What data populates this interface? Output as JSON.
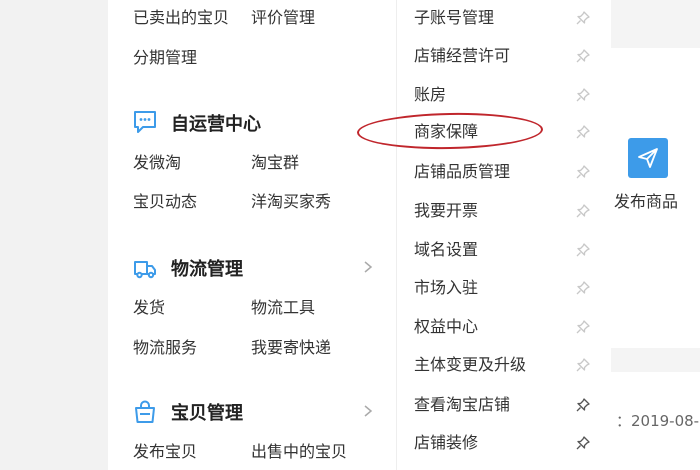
{
  "seller_menu": {
    "top_links": [
      "已卖出的宝贝",
      "评价管理",
      "分期管理"
    ],
    "sections": [
      {
        "title": "自运营中心",
        "icon": "chat-bubble-icon",
        "links": [
          "发微淘",
          "淘宝群",
          "宝贝动态",
          "洋淘买家秀"
        ]
      },
      {
        "title": "物流管理",
        "icon": "delivery-truck-icon",
        "links": [
          "发货",
          "物流工具",
          "物流服务",
          "我要寄快递"
        ]
      },
      {
        "title": "宝贝管理",
        "icon": "shopping-bag-icon",
        "links": [
          "发布宝贝",
          "出售中的宝贝"
        ]
      }
    ]
  },
  "submenu": {
    "items": [
      "子账号管理",
      "店铺经营许可",
      "账房",
      "商家保障",
      "店铺品质管理",
      "我要开票",
      "域名设置",
      "市场入驻",
      "权益中心",
      "主体变更及升级",
      "查看淘宝店铺",
      "店铺装修"
    ],
    "highlighted": "商家保障"
  },
  "right_panel": {
    "publish_label": "发布商品",
    "date_text": "：2019-08-"
  },
  "colors": {
    "accent_blue": "#3d9be9",
    "annotation_red": "#c0262c"
  }
}
